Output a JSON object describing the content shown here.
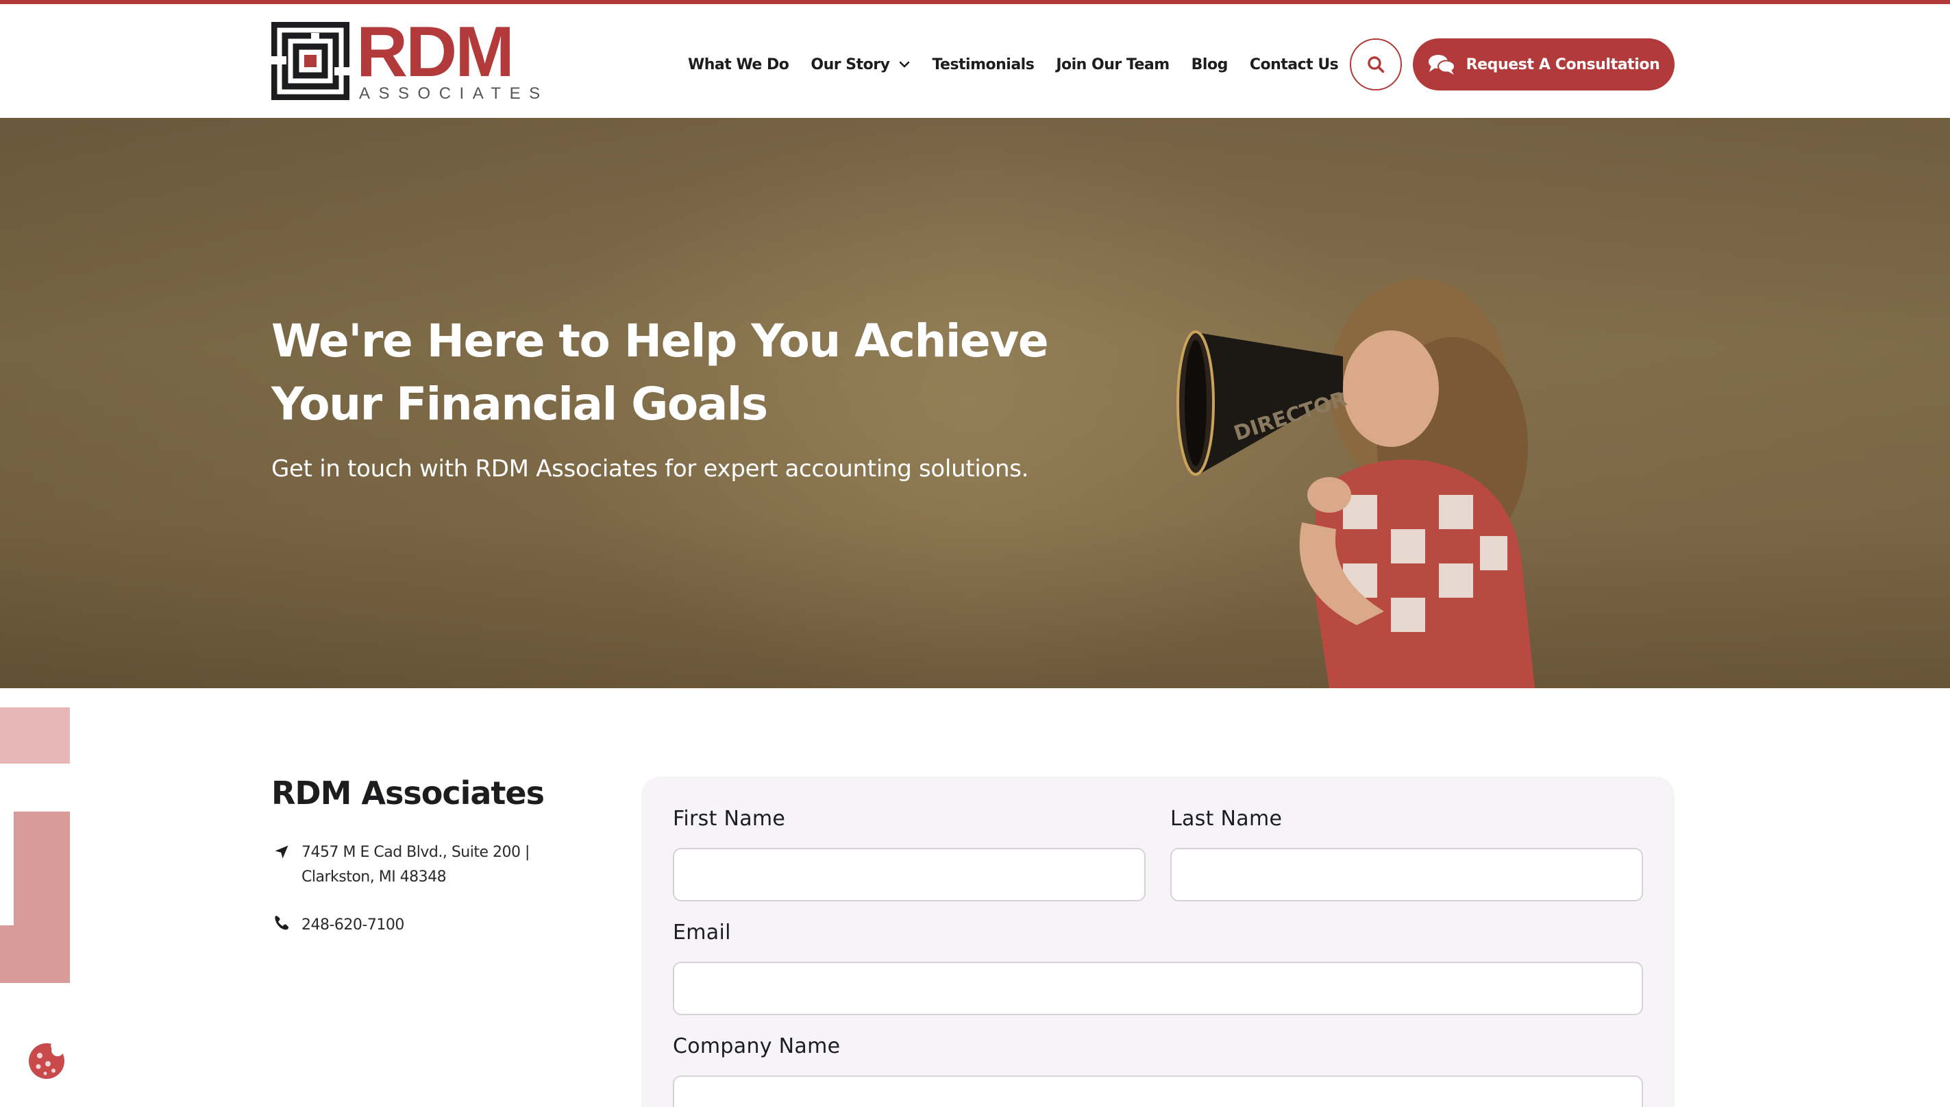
{
  "brand": {
    "name": "RDM",
    "subtitle": "ASSOCIATES",
    "accent_color": "#b23a3a"
  },
  "nav": {
    "items": [
      {
        "label": "What We Do"
      },
      {
        "label": "Our Story",
        "has_dropdown": true
      },
      {
        "label": "Testimonials"
      },
      {
        "label": "Join Our Team"
      },
      {
        "label": "Blog"
      },
      {
        "label": "Contact Us"
      }
    ],
    "search_icon": "search-icon",
    "cta_label": "Request A Consultation",
    "cta_icon": "chat-bubbles-icon"
  },
  "hero": {
    "title": "We're Here to Help You Achieve Your Financial Goals",
    "subtitle": "Get in touch with RDM Associates for expert accounting solutions.",
    "image_text": "DIRECTOR"
  },
  "contact": {
    "company": "RDM Associates",
    "address_line1": "7457 M E Cad Blvd., Suite 200 |",
    "address_line2": "Clarkston, MI 48348",
    "phone": "248-620-7100",
    "address_icon": "location-arrow-icon",
    "phone_icon": "phone-icon"
  },
  "form": {
    "first_name_label": "First  Name",
    "last_name_label": "Last  Name",
    "email_label": "Email",
    "company_label": "Company  Name",
    "first_name_value": "",
    "last_name_value": "",
    "email_value": "",
    "company_value": ""
  },
  "cookie_icon": "cookie-icon"
}
